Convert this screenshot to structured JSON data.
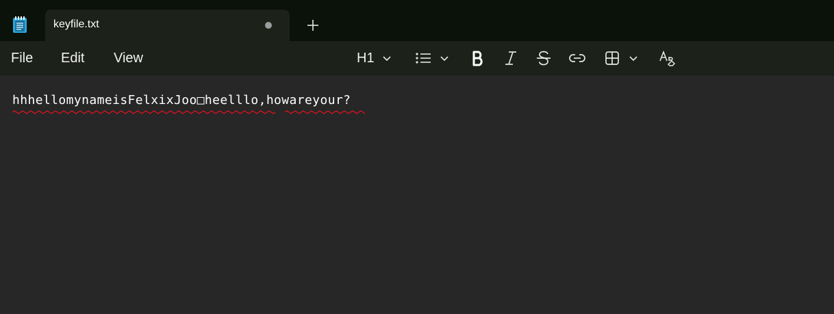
{
  "app": {
    "icon": "notepad-icon"
  },
  "tab": {
    "title": "keyfile.txt",
    "status": "unsaved-dot-icon",
    "new_tab_icon": "plus-icon"
  },
  "menu": {
    "items": [
      "File",
      "Edit",
      "View"
    ]
  },
  "toolbar": {
    "heading_label": "H1",
    "icons": [
      "heading-chevron-down-icon",
      "bulleted-list-icon",
      "list-chevron-down-icon",
      "bold-icon",
      "italic-icon",
      "strikethrough-icon",
      "link-icon",
      "table-icon",
      "table-chevron-down-icon",
      "clear-formatting-icon"
    ]
  },
  "editor": {
    "content": "hhhellomynameisFelxixJoo□heelllo,howareyour?"
  },
  "colors": {
    "titlebar": "#0b1209",
    "tab_active": "#1c2119",
    "editor_background": "#272727",
    "spellcheck_underline": "#e81123"
  }
}
